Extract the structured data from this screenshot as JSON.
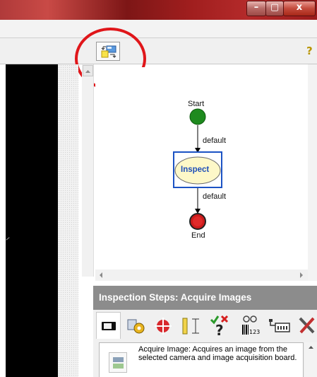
{
  "window": {
    "minimize_glyph": "–",
    "maximize_glyph": "▢",
    "close_glyph": "x"
  },
  "toolbar": {
    "flow_view_icon": "flow-view-icon",
    "help_glyph": "?"
  },
  "flowchart": {
    "start_label": "Start",
    "edge1_label": "default",
    "step_label": "Inspect",
    "edge2_label": "default",
    "end_label": "End",
    "colors": {
      "start": "#1e8a1e",
      "end": "#cc1b1b",
      "step_fill": "#fdf8c8",
      "step_border": "#1c53c4",
      "step_text": "#2050b8"
    }
  },
  "inspection_steps": {
    "header": "Inspection Steps: Acquire Images",
    "tools": [
      "acquire-image-icon",
      "gear-cog-icon",
      "crosshair-target-icon",
      "caliper-measure-icon",
      "pass-fail-icon",
      "barcode-reader-icon",
      "io-plug-icon",
      "tools-icon"
    ],
    "barcode_text": "123",
    "description": "Acquire Image:  Acquires an image from the selected camera and image acquisition board."
  },
  "highlight_color": "#e0161a"
}
